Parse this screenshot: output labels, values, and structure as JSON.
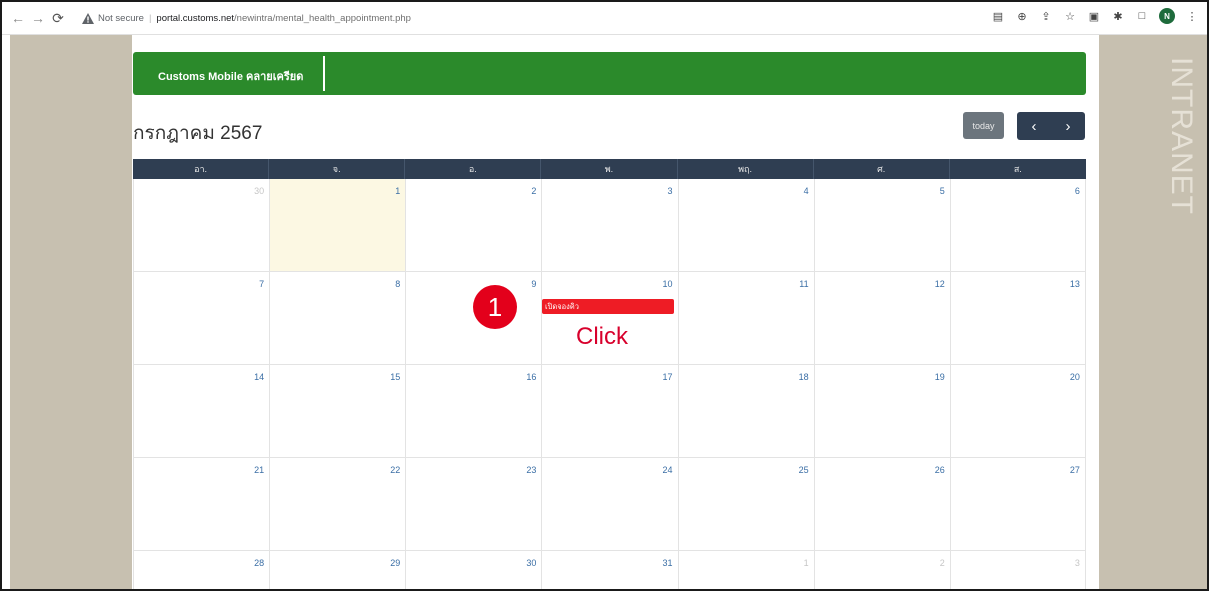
{
  "browser": {
    "security_label": "Not secure",
    "url_host": "portal.customs.net",
    "url_path": "/newintra/mental_health_appointment.php",
    "avatar_letter": "N"
  },
  "side_text": "INTRANET",
  "header": {
    "title": "Customs Mobile คลายเครียด"
  },
  "calendar": {
    "month_title": "กรกฎาคม 2567",
    "today_label": "today",
    "prev_symbol": "‹",
    "next_symbol": "›",
    "weekdays": [
      "อา.",
      "จ.",
      "อ.",
      "พ.",
      "พฤ.",
      "ศ.",
      "ส."
    ],
    "weeks": [
      [
        {
          "d": "30",
          "other": true
        },
        {
          "d": "1",
          "today": true
        },
        {
          "d": "2"
        },
        {
          "d": "3"
        },
        {
          "d": "4"
        },
        {
          "d": "5"
        },
        {
          "d": "6"
        }
      ],
      [
        {
          "d": "7"
        },
        {
          "d": "8"
        },
        {
          "d": "9"
        },
        {
          "d": "10"
        },
        {
          "d": "11"
        },
        {
          "d": "12"
        },
        {
          "d": "13"
        }
      ],
      [
        {
          "d": "14"
        },
        {
          "d": "15"
        },
        {
          "d": "16"
        },
        {
          "d": "17"
        },
        {
          "d": "18"
        },
        {
          "d": "19"
        },
        {
          "d": "20"
        }
      ],
      [
        {
          "d": "21"
        },
        {
          "d": "22"
        },
        {
          "d": "23"
        },
        {
          "d": "24"
        },
        {
          "d": "25"
        },
        {
          "d": "26"
        },
        {
          "d": "27"
        }
      ],
      [
        {
          "d": "28"
        },
        {
          "d": "29"
        },
        {
          "d": "30"
        },
        {
          "d": "31"
        },
        {
          "d": "1",
          "other": true
        },
        {
          "d": "2",
          "other": true
        },
        {
          "d": "3",
          "other": true
        }
      ]
    ],
    "event_label": "เปิดจองคิว"
  },
  "annotation": {
    "step_number": "1",
    "instruction": "Click"
  },
  "colors": {
    "header_green": "#2b8a2b",
    "nav_dark": "#2f3e52",
    "event_red": "#ee1c25",
    "annotation_red": "#d8002c",
    "today_highlight": "#fcf8e3"
  }
}
